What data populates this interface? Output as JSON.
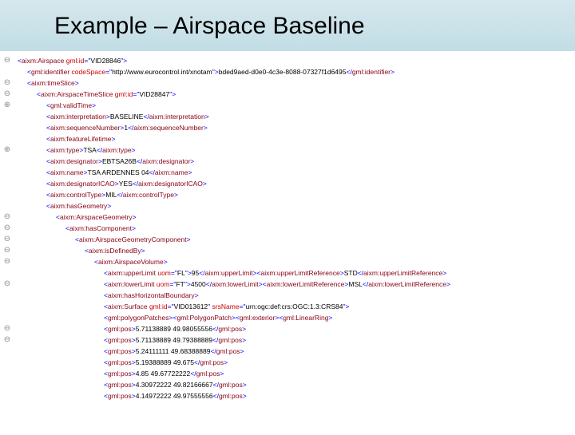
{
  "title": "Example – Airspace Baseline",
  "gutter": [
    "⊖",
    "",
    "⊖",
    "⊖",
    "⊕",
    "",
    "",
    "",
    "⊕",
    "",
    "",
    "",
    "",
    "",
    "⊖",
    "⊖",
    "⊖",
    "⊖",
    "⊖",
    "",
    "⊖",
    "",
    "",
    "",
    "⊖",
    "⊖",
    "",
    "",
    "",
    "",
    "",
    "",
    "",
    ""
  ],
  "xml": [
    {
      "depth": 0,
      "parts": [
        {
          "type": "open",
          "tag": "aixm:Airspace",
          "attrs": [
            {
              "n": "gml:id",
              "v": "VID28846"
            }
          ]
        }
      ]
    },
    {
      "depth": 1,
      "parts": [
        {
          "type": "open",
          "tag": "gml:identifier",
          "attrs": [
            {
              "n": "codeSpace",
              "v": "http://www.eurocontrol.int/xnotam"
            }
          ]
        },
        {
          "type": "text",
          "v": "bded9aed-d0e0-4c3e-8088-07327f1d6495"
        },
        {
          "type": "close",
          "tag": "gml:identifier"
        }
      ]
    },
    {
      "depth": 1,
      "parts": [
        {
          "type": "open",
          "tag": "aixm:timeSlice"
        }
      ]
    },
    {
      "depth": 2,
      "parts": [
        {
          "type": "open",
          "tag": "aixm:AirspaceTimeSlice",
          "attrs": [
            {
              "n": "gml:id",
              "v": "VID28847"
            }
          ]
        }
      ]
    },
    {
      "depth": 3,
      "parts": [
        {
          "type": "open",
          "tag": "gml:validTime"
        }
      ]
    },
    {
      "depth": 3,
      "parts": [
        {
          "type": "open",
          "tag": "aixm:interpretation"
        },
        {
          "type": "text",
          "v": "BASELINE"
        },
        {
          "type": "close",
          "tag": "aixm:interpretation"
        }
      ]
    },
    {
      "depth": 3,
      "parts": [
        {
          "type": "open",
          "tag": "aixm:sequenceNumber"
        },
        {
          "type": "text",
          "v": "1"
        },
        {
          "type": "close",
          "tag": "aixm:sequenceNumber"
        }
      ]
    },
    {
      "depth": 3,
      "parts": [
        {
          "type": "open",
          "tag": "aixm:featureLifetime"
        }
      ]
    },
    {
      "depth": 3,
      "parts": [
        {
          "type": "open",
          "tag": "aixm:type"
        },
        {
          "type": "text",
          "v": "TSA"
        },
        {
          "type": "close",
          "tag": "aixm:type"
        }
      ]
    },
    {
      "depth": 3,
      "parts": [
        {
          "type": "open",
          "tag": "aixm:designator"
        },
        {
          "type": "text",
          "v": "EBTSA26B"
        },
        {
          "type": "close",
          "tag": "aixm:designator"
        }
      ]
    },
    {
      "depth": 3,
      "parts": [
        {
          "type": "open",
          "tag": "aixm:name"
        },
        {
          "type": "text",
          "v": "TSA ARDENNES 04"
        },
        {
          "type": "close",
          "tag": "aixm:name"
        }
      ]
    },
    {
      "depth": 3,
      "parts": [
        {
          "type": "open",
          "tag": "aixm:designatorICAO"
        },
        {
          "type": "text",
          "v": "YES"
        },
        {
          "type": "close",
          "tag": "aixm:designatorICAO"
        }
      ]
    },
    {
      "depth": 3,
      "parts": [
        {
          "type": "open",
          "tag": "aixm:controlType"
        },
        {
          "type": "text",
          "v": "MIL"
        },
        {
          "type": "close",
          "tag": "aixm:controlType"
        }
      ]
    },
    {
      "depth": 3,
      "parts": [
        {
          "type": "open",
          "tag": "aixm:hasGeometry"
        }
      ]
    },
    {
      "depth": 4,
      "parts": [
        {
          "type": "open",
          "tag": "aixm:AirspaceGeometry"
        }
      ]
    },
    {
      "depth": 5,
      "parts": [
        {
          "type": "open",
          "tag": "aixm:hasComponent"
        }
      ]
    },
    {
      "depth": 6,
      "parts": [
        {
          "type": "open",
          "tag": "aixm:AirspaceGeometryComponent"
        }
      ]
    },
    {
      "depth": 7,
      "parts": [
        {
          "type": "open",
          "tag": "aixm:isDefinedBy"
        }
      ]
    },
    {
      "depth": 8,
      "parts": [
        {
          "type": "open",
          "tag": "aixm:AirspaceVolume"
        }
      ]
    },
    {
      "depth": 9,
      "parts": [
        {
          "type": "open",
          "tag": "aixm:upperLimit",
          "attrs": [
            {
              "n": "uom",
              "v": "FL"
            }
          ]
        },
        {
          "type": "text",
          "v": "95"
        },
        {
          "type": "close",
          "tag": "aixm:upperLimit"
        },
        {
          "type": "open",
          "tag": "aixm:upperLimitReference"
        },
        {
          "type": "text",
          "v": "STD"
        },
        {
          "type": "close",
          "tag": "aixm:upperLimitReference"
        }
      ]
    },
    {
      "depth": 9,
      "parts": [
        {
          "type": "open",
          "tag": "aixm:lowerLimit",
          "attrs": [
            {
              "n": "uom",
              "v": "FT"
            }
          ]
        },
        {
          "type": "text",
          "v": "4500"
        },
        {
          "type": "close",
          "tag": "aixm:lowerLimit"
        },
        {
          "type": "open",
          "tag": "aixm:lowerLimitReference"
        },
        {
          "type": "text",
          "v": "MSL"
        },
        {
          "type": "close",
          "tag": "aixm:lowerLimitReference"
        }
      ]
    },
    {
      "depth": 9,
      "parts": [
        {
          "type": "open",
          "tag": "aixm:hasHorizontalBoundary"
        }
      ]
    },
    {
      "depth": 9,
      "parts": [
        {
          "type": "open",
          "tag": "aixm:Surface",
          "attrs": [
            {
              "n": "gml:id",
              "v": "VID013612"
            },
            {
              "n": "srsName",
              "v": "urn:ogc:def:crs:OGC:1.3:CRS84"
            }
          ]
        }
      ]
    },
    {
      "depth": 9,
      "parts": [
        {
          "type": "open",
          "tag": "gml:polygonPatches"
        },
        {
          "type": "open",
          "tag": "gml:PolygonPatch"
        },
        {
          "type": "open",
          "tag": "gml:exterior"
        },
        {
          "type": "open",
          "tag": "gml:LinearRing"
        }
      ]
    },
    {
      "depth": 9,
      "parts": [
        {
          "type": "open",
          "tag": "gml:pos"
        },
        {
          "type": "text",
          "v": "5.71138889 49.98055556"
        },
        {
          "type": "close",
          "tag": "gml:pos"
        }
      ]
    },
    {
      "depth": 9,
      "parts": [
        {
          "type": "open",
          "tag": "gml:pos"
        },
        {
          "type": "text",
          "v": "5.71138889 49.79388889"
        },
        {
          "type": "close",
          "tag": "gml:pos"
        }
      ]
    },
    {
      "depth": 9,
      "parts": [
        {
          "type": "open",
          "tag": "gml:pos"
        },
        {
          "type": "text",
          "v": "5.24111111 49.68388889"
        },
        {
          "type": "close",
          "tag": "gml:pos"
        }
      ]
    },
    {
      "depth": 9,
      "parts": [
        {
          "type": "open",
          "tag": "gml:pos"
        },
        {
          "type": "text",
          "v": "5.19388889 49.675"
        },
        {
          "type": "close",
          "tag": "gml:pos"
        }
      ]
    },
    {
      "depth": 9,
      "parts": [
        {
          "type": "open",
          "tag": "gml:pos"
        },
        {
          "type": "text",
          "v": "4.85 49.67722222"
        },
        {
          "type": "close",
          "tag": "gml:pos"
        }
      ]
    },
    {
      "depth": 9,
      "parts": [
        {
          "type": "open",
          "tag": "gml:pos"
        },
        {
          "type": "text",
          "v": "4.30972222 49.82166667"
        },
        {
          "type": "close",
          "tag": "gml:pos"
        }
      ]
    },
    {
      "depth": 9,
      "parts": [
        {
          "type": "open",
          "tag": "gml:pos"
        },
        {
          "type": "text",
          "v": "4.14972222 49.97555556"
        },
        {
          "type": "close",
          "tag": "gml:pos"
        }
      ]
    }
  ]
}
